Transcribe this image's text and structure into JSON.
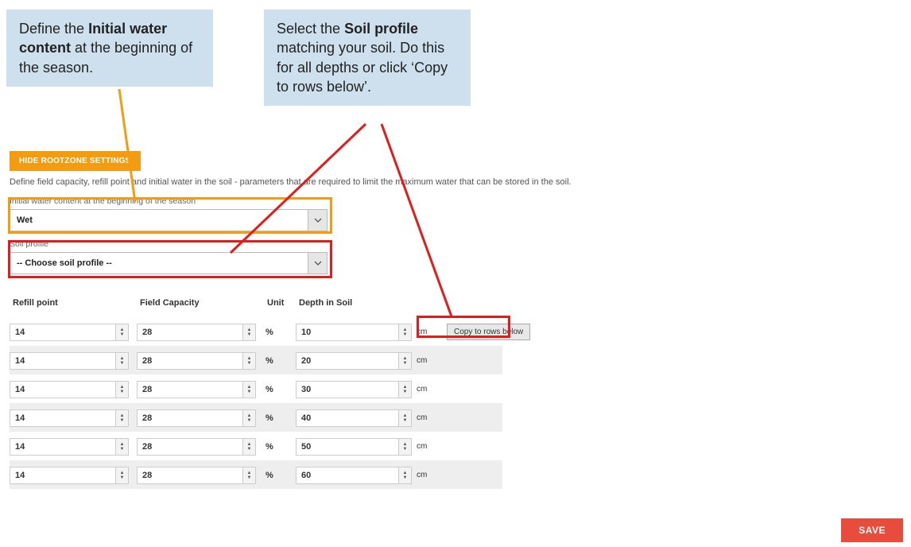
{
  "callouts": {
    "left_pre": "Define the ",
    "left_bold": "Initial water content",
    "left_post": " at the beginning of the season.",
    "right_pre": "Select the ",
    "right_bold": "Soil profile",
    "right_post": " matching your soil. Do this for all depths or click ‘Copy to rows below’."
  },
  "buttons": {
    "hide": "HIDE ROOTZONE SETTINGS",
    "save": "SAVE",
    "copy": "Copy to rows below"
  },
  "description": "Define field capacity, refill point and initial water in the soil - parameters that are required to limit the maximum water that can be stored in the soil.",
  "fields": {
    "initial_label": "Initial water content at the beginning of the season",
    "initial_value": "Wet",
    "soil_label": "Soil profile",
    "soil_value": "-- Choose soil profile --"
  },
  "table": {
    "headers": {
      "refill": "Refill point",
      "capacity": "Field Capacity",
      "unit": "Unit",
      "depth": "Depth in Soil"
    },
    "rows": [
      {
        "refill": "14",
        "capacity": "28",
        "unit": "%",
        "depth": "10",
        "cm": "cm",
        "copy": true
      },
      {
        "refill": "14",
        "capacity": "28",
        "unit": "%",
        "depth": "20",
        "cm": "cm"
      },
      {
        "refill": "14",
        "capacity": "28",
        "unit": "%",
        "depth": "30",
        "cm": "cm"
      },
      {
        "refill": "14",
        "capacity": "28",
        "unit": "%",
        "depth": "40",
        "cm": "cm"
      },
      {
        "refill": "14",
        "capacity": "28",
        "unit": "%",
        "depth": "50",
        "cm": "cm"
      },
      {
        "refill": "14",
        "capacity": "28",
        "unit": "%",
        "depth": "60",
        "cm": "cm"
      }
    ]
  }
}
